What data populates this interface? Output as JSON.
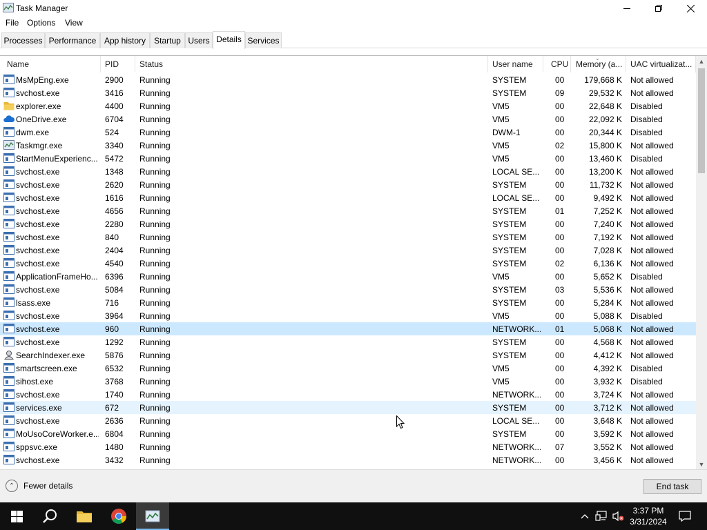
{
  "window": {
    "title": "Task Manager"
  },
  "menu": [
    "File",
    "Options",
    "View"
  ],
  "tabs": [
    "Processes",
    "Performance",
    "App history",
    "Startup",
    "Users",
    "Details",
    "Services"
  ],
  "active_tab": "Details",
  "columns": {
    "name": "Name",
    "pid": "PID",
    "status": "Status",
    "user": "User name",
    "cpu": "CPU",
    "memory": "Memory (a...",
    "uac": "UAC virtualizat..."
  },
  "rows": [
    {
      "name": "MsMpEng.exe",
      "pid": "2900",
      "status": "Running",
      "user": "SYSTEM",
      "cpu": "00",
      "memory": "179,668 K",
      "uac": "Not allowed",
      "icon": "app-window-icon"
    },
    {
      "name": "svchost.exe",
      "pid": "3416",
      "status": "Running",
      "user": "SYSTEM",
      "cpu": "09",
      "memory": "29,532 K",
      "uac": "Not allowed",
      "icon": "app-window-icon"
    },
    {
      "name": "explorer.exe",
      "pid": "4400",
      "status": "Running",
      "user": "VM5",
      "cpu": "00",
      "memory": "22,648 K",
      "uac": "Disabled",
      "icon": "folder-icon"
    },
    {
      "name": "OneDrive.exe",
      "pid": "6704",
      "status": "Running",
      "user": "VM5",
      "cpu": "00",
      "memory": "22,092 K",
      "uac": "Disabled",
      "icon": "cloud-icon"
    },
    {
      "name": "dwm.exe",
      "pid": "524",
      "status": "Running",
      "user": "DWM-1",
      "cpu": "00",
      "memory": "20,344 K",
      "uac": "Disabled",
      "icon": "app-window-icon"
    },
    {
      "name": "Taskmgr.exe",
      "pid": "3340",
      "status": "Running",
      "user": "VM5",
      "cpu": "02",
      "memory": "15,800 K",
      "uac": "Not allowed",
      "icon": "task-manager-icon"
    },
    {
      "name": "StartMenuExperienc...",
      "pid": "5472",
      "status": "Running",
      "user": "VM5",
      "cpu": "00",
      "memory": "13,460 K",
      "uac": "Disabled",
      "icon": "app-window-icon"
    },
    {
      "name": "svchost.exe",
      "pid": "1348",
      "status": "Running",
      "user": "LOCAL SE...",
      "cpu": "00",
      "memory": "13,200 K",
      "uac": "Not allowed",
      "icon": "app-window-icon"
    },
    {
      "name": "svchost.exe",
      "pid": "2620",
      "status": "Running",
      "user": "SYSTEM",
      "cpu": "00",
      "memory": "11,732 K",
      "uac": "Not allowed",
      "icon": "app-window-icon"
    },
    {
      "name": "svchost.exe",
      "pid": "1616",
      "status": "Running",
      "user": "LOCAL SE...",
      "cpu": "00",
      "memory": "9,492 K",
      "uac": "Not allowed",
      "icon": "app-window-icon"
    },
    {
      "name": "svchost.exe",
      "pid": "4656",
      "status": "Running",
      "user": "SYSTEM",
      "cpu": "01",
      "memory": "7,252 K",
      "uac": "Not allowed",
      "icon": "app-window-icon"
    },
    {
      "name": "svchost.exe",
      "pid": "2280",
      "status": "Running",
      "user": "SYSTEM",
      "cpu": "00",
      "memory": "7,240 K",
      "uac": "Not allowed",
      "icon": "app-window-icon"
    },
    {
      "name": "svchost.exe",
      "pid": "840",
      "status": "Running",
      "user": "SYSTEM",
      "cpu": "00",
      "memory": "7,192 K",
      "uac": "Not allowed",
      "icon": "app-window-icon"
    },
    {
      "name": "svchost.exe",
      "pid": "2404",
      "status": "Running",
      "user": "SYSTEM",
      "cpu": "00",
      "memory": "7,028 K",
      "uac": "Not allowed",
      "icon": "app-window-icon"
    },
    {
      "name": "svchost.exe",
      "pid": "4540",
      "status": "Running",
      "user": "SYSTEM",
      "cpu": "02",
      "memory": "6,136 K",
      "uac": "Not allowed",
      "icon": "app-window-icon"
    },
    {
      "name": "ApplicationFrameHo...",
      "pid": "6396",
      "status": "Running",
      "user": "VM5",
      "cpu": "00",
      "memory": "5,652 K",
      "uac": "Disabled",
      "icon": "app-window-icon"
    },
    {
      "name": "svchost.exe",
      "pid": "5084",
      "status": "Running",
      "user": "SYSTEM",
      "cpu": "03",
      "memory": "5,536 K",
      "uac": "Not allowed",
      "icon": "app-window-icon"
    },
    {
      "name": "lsass.exe",
      "pid": "716",
      "status": "Running",
      "user": "SYSTEM",
      "cpu": "00",
      "memory": "5,284 K",
      "uac": "Not allowed",
      "icon": "app-window-icon"
    },
    {
      "name": "svchost.exe",
      "pid": "3964",
      "status": "Running",
      "user": "VM5",
      "cpu": "00",
      "memory": "5,088 K",
      "uac": "Disabled",
      "icon": "app-window-icon"
    },
    {
      "name": "svchost.exe",
      "pid": "960",
      "status": "Running",
      "user": "NETWORK...",
      "cpu": "01",
      "memory": "5,068 K",
      "uac": "Not allowed",
      "icon": "app-window-icon",
      "state": "selected"
    },
    {
      "name": "svchost.exe",
      "pid": "1292",
      "status": "Running",
      "user": "SYSTEM",
      "cpu": "00",
      "memory": "4,568 K",
      "uac": "Not allowed",
      "icon": "app-window-icon"
    },
    {
      "name": "SearchIndexer.exe",
      "pid": "5876",
      "status": "Running",
      "user": "SYSTEM",
      "cpu": "00",
      "memory": "4,412 K",
      "uac": "Not allowed",
      "icon": "search-indexer-icon"
    },
    {
      "name": "smartscreen.exe",
      "pid": "6532",
      "status": "Running",
      "user": "VM5",
      "cpu": "00",
      "memory": "4,392 K",
      "uac": "Disabled",
      "icon": "app-window-icon"
    },
    {
      "name": "sihost.exe",
      "pid": "3768",
      "status": "Running",
      "user": "VM5",
      "cpu": "00",
      "memory": "3,932 K",
      "uac": "Disabled",
      "icon": "app-window-icon"
    },
    {
      "name": "svchost.exe",
      "pid": "1740",
      "status": "Running",
      "user": "NETWORK...",
      "cpu": "00",
      "memory": "3,724 K",
      "uac": "Not allowed",
      "icon": "app-window-icon"
    },
    {
      "name": "services.exe",
      "pid": "672",
      "status": "Running",
      "user": "SYSTEM",
      "cpu": "00",
      "memory": "3,712 K",
      "uac": "Not allowed",
      "icon": "app-window-icon",
      "state": "hover"
    },
    {
      "name": "svchost.exe",
      "pid": "2636",
      "status": "Running",
      "user": "LOCAL SE...",
      "cpu": "00",
      "memory": "3,648 K",
      "uac": "Not allowed",
      "icon": "app-window-icon"
    },
    {
      "name": "MoUsoCoreWorker.e...",
      "pid": "6804",
      "status": "Running",
      "user": "SYSTEM",
      "cpu": "00",
      "memory": "3,592 K",
      "uac": "Not allowed",
      "icon": "app-window-icon"
    },
    {
      "name": "sppsvc.exe",
      "pid": "1480",
      "status": "Running",
      "user": "NETWORK...",
      "cpu": "07",
      "memory": "3,552 K",
      "uac": "Not allowed",
      "icon": "app-window-icon"
    },
    {
      "name": "svchost.exe",
      "pid": "3432",
      "status": "Running",
      "user": "NETWORK...",
      "cpu": "00",
      "memory": "3,456 K",
      "uac": "Not allowed",
      "icon": "app-window-icon"
    }
  ],
  "footer": {
    "fewer_details": "Fewer details",
    "end_task": "End task"
  },
  "taskbar": {
    "time": "3:37 PM",
    "date": "3/31/2024"
  },
  "colors": {
    "selected_row": "#cce8ff",
    "hover_row": "#e5f3ff",
    "taskbar": "#101010",
    "accent": "#76b9ed"
  }
}
